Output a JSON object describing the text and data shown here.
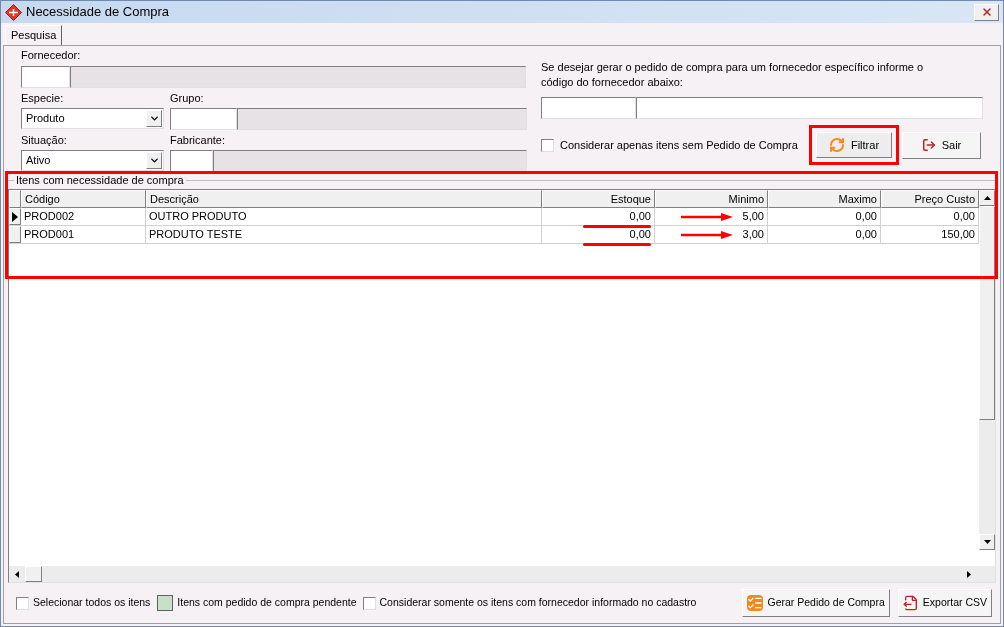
{
  "window": {
    "title": "Necessidade de Compra"
  },
  "tabs": [
    {
      "label": "Pesquisa",
      "selected": true
    }
  ],
  "filters": {
    "fornecedor": {
      "label": "Fornecedor:"
    },
    "especie": {
      "label": "Especie:",
      "value": "Produto"
    },
    "grupo": {
      "label": "Grupo:"
    },
    "situacao": {
      "label": "Situação:",
      "value": "Ativo"
    },
    "fabricante": {
      "label": "Fabricante:"
    }
  },
  "supplier_hint": "Se desejar gerar o pedido de compra para um fornecedor específico informe o código do fornecedor abaixo:",
  "only_without_order": {
    "label": "Considerar apenas itens sem Pedido de Compra",
    "checked": false
  },
  "filter_button": {
    "label": "Filtrar",
    "highlighted": true
  },
  "exit_button": {
    "label": "Sair"
  },
  "grid": {
    "title": "Itens com necessidade de compra",
    "highlighted": true,
    "columns": [
      "Código",
      "Descrição",
      "Estoque",
      "Minimo",
      "Maximo",
      "Preço Custo"
    ],
    "rows": [
      {
        "selected": true,
        "annotated": true,
        "cells": [
          "PROD002",
          "OUTRO PRODUTO",
          "0,00",
          "5,00",
          "0,00",
          "0,00"
        ]
      },
      {
        "selected": false,
        "annotated": true,
        "cells": [
          "PROD001",
          "PRODUTO TESTE",
          "0,00",
          "3,00",
          "0,00",
          "150,00"
        ]
      }
    ]
  },
  "footer": {
    "select_all": {
      "label": "Selecionar todos os itens",
      "checked": false
    },
    "legend": {
      "label": "Itens com pedido de compra pendente"
    },
    "only_supplier": {
      "label": "Considerar somente os itens com fornecedor informado no cadastro",
      "checked": false
    },
    "buttons": [
      {
        "kind": "generate",
        "label": "Gerar Pedido de Compra"
      },
      {
        "kind": "export",
        "label": "Exportar CSV"
      }
    ]
  }
}
